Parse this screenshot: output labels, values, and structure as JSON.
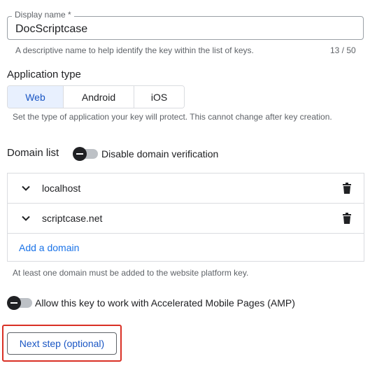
{
  "display_name": {
    "label": "Display name *",
    "value": "DocScriptcase",
    "hint": "A descriptive name to help identify the key within the list of keys.",
    "counter": "13 / 50"
  },
  "application_type": {
    "title": "Application type",
    "options": [
      {
        "label": "Web",
        "selected": true
      },
      {
        "label": "Android",
        "selected": false
      },
      {
        "label": "iOS",
        "selected": false
      }
    ],
    "hint": "Set the type of application your key will protect. This cannot change after key creation."
  },
  "domain_list": {
    "title": "Domain list",
    "toggle_label": "Disable domain verification",
    "domains": [
      "localhost",
      "scriptcase.net"
    ],
    "add_label": "Add a domain",
    "hint": "At least one domain must be added to the website platform key."
  },
  "amp": {
    "toggle_label": "Allow this key to work with Accelerated Mobile Pages (AMP)"
  },
  "next_button": {
    "label": "Next step (optional)"
  },
  "colors": {
    "accent": "#1a73e8",
    "selected_bg": "#e8f0fe",
    "highlight": "#d93025"
  },
  "icons": {
    "chevron": "chevron-down-icon",
    "delete": "trash-icon"
  }
}
